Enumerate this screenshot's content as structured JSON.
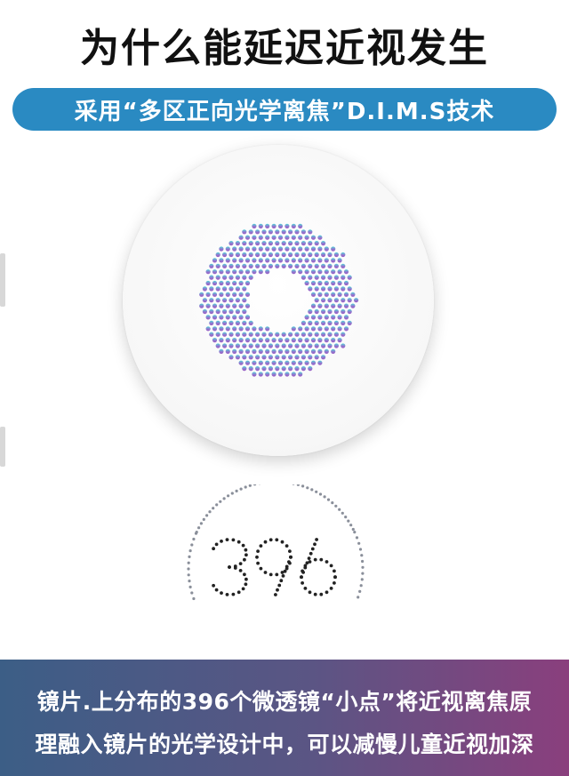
{
  "header": {
    "title": "为什么能延迟近视发生",
    "subtitle": "采用“多区正向光学离焦”D.I.M.S技术"
  },
  "illustration": {
    "lens_icon": "lens-dot-ring-icon",
    "counter_value": "396",
    "colors": {
      "ring_top": "#4fd6d9",
      "ring_mid": "#8e7fd0",
      "ring_bottom": "#9a58c4",
      "counter_dots": "#222222",
      "arc_dots": "#8a8f9a"
    }
  },
  "footer": {
    "line1": "镜片.上分布的396个微透镜“小点”将近视离焦原",
    "line2": "理融入镜片的光学设计中，可以减慢儿童近视加深",
    "colors": {
      "left": "#3c5e86",
      "right": "#8a3f7d"
    }
  }
}
